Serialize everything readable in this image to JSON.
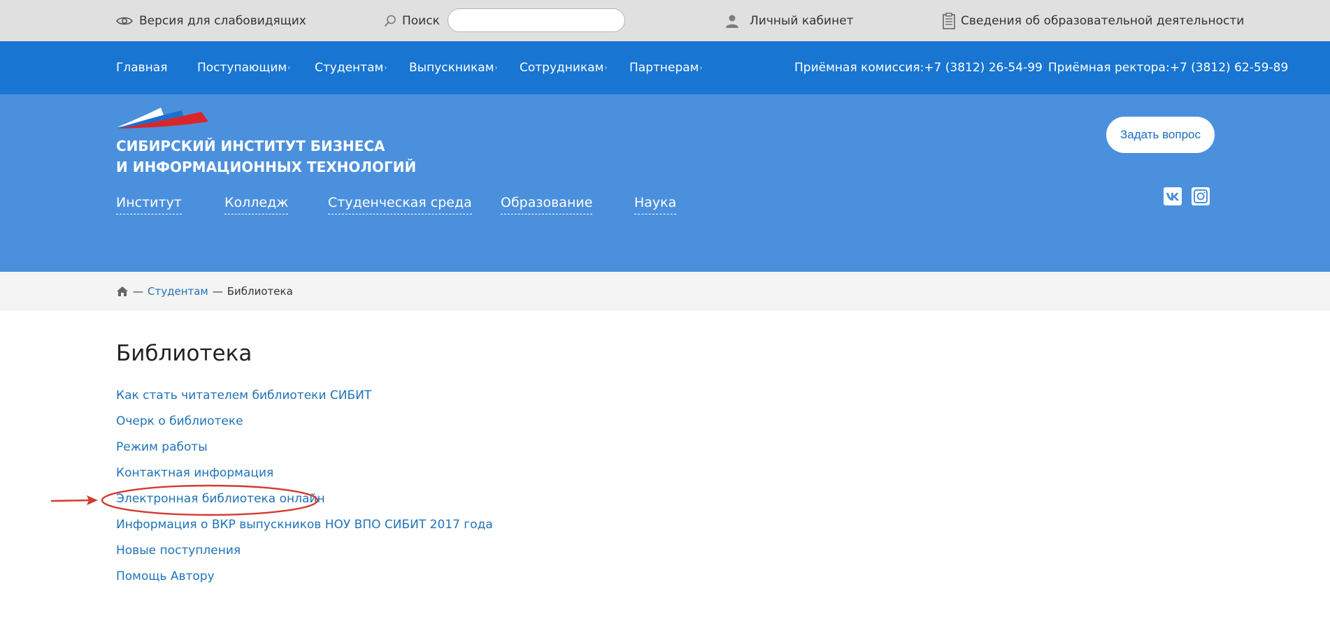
{
  "topbar": {
    "accessibility_label": "Версия для слабовидящих",
    "search_label": "Поиск",
    "search_value": "",
    "cabinet_label": "Личный кабинет",
    "edu_info_label": "Сведения об образовательной деятельности"
  },
  "mainnav": {
    "items": [
      "Главная",
      "Поступающим",
      "Студентам",
      "Выпускникам",
      "Сотрудникам",
      "Партнерам"
    ],
    "phone_admission": "Приёмная комиссия:+7 (3812) 26-54-99",
    "phone_rector": "Приёмная ректора:+7 (3812) 62-59-89"
  },
  "logo": {
    "line1": "СИБИРСКИЙ ИНСТИТУТ БИЗНЕСА",
    "line2": "И ИНФОРМАЦИОННЫХ ТЕХНОЛОГИЙ",
    "colors": [
      "#ffffff",
      "#1b6fd0",
      "#d9262a"
    ]
  },
  "hero_menu": [
    "Институт",
    "Колледж",
    "Студенческая среда",
    "Образование",
    "Наука"
  ],
  "ask_button": "Задать вопрос",
  "social": [
    "vk-icon",
    "instagram-icon"
  ],
  "breadcrumb": {
    "separator": "—",
    "parent": "Студентам",
    "current": "Библиотека"
  },
  "content": {
    "title": "Библиотека",
    "links": [
      "Как стать читателем библиотеки СИБИТ",
      "Очерк о библиотеке",
      "Режим работы",
      "Контактная информация",
      "Электронная библиотека онлайн",
      "Информация о ВКР выпускников НОУ ВПО СИБИТ 2017 года",
      "Новые поступления",
      "Помощь Автору"
    ]
  },
  "colors": {
    "topbar_bg": "#e0e0e0",
    "nav_bg": "#1875d1",
    "hero_bg": "#4b90dc",
    "link": "#1f72b8",
    "annotation": "#d33b2f"
  }
}
